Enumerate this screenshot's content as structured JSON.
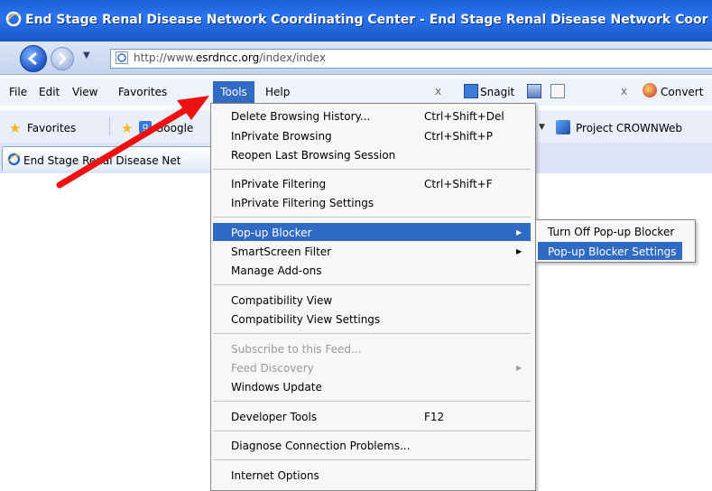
{
  "window": {
    "title": "End Stage Renal Disease Network Coordinating Center - End Stage Renal Disease Network Coor"
  },
  "address": {
    "url_prefix": "http://www.",
    "url_host": "esrdncc.org",
    "url_path": "/index/index"
  },
  "menubar": {
    "items": [
      "File",
      "Edit",
      "View",
      "Favorites",
      "Tools",
      "Help"
    ],
    "snagit_label": "Snagit",
    "convert_label": "Convert",
    "close_glyph": "x"
  },
  "favorites_bar": {
    "favorites_label": "Favorites",
    "google_label": "Google",
    "project_label": "Project CROWNWeb"
  },
  "tab": {
    "label": "End Stage Renal Disease Net"
  },
  "tools_menu": {
    "items": [
      {
        "label": "Delete Browsing History...",
        "shortcut": "Ctrl+Shift+Del"
      },
      {
        "label": "InPrivate Browsing",
        "shortcut": "Ctrl+Shift+P"
      },
      {
        "label": "Reopen Last Browsing Session",
        "shortcut": ""
      },
      {
        "label": "InPrivate Filtering",
        "shortcut": "Ctrl+Shift+F"
      },
      {
        "label": "InPrivate Filtering Settings",
        "shortcut": ""
      },
      {
        "label": "Pop-up Blocker",
        "shortcut": "",
        "submenu": true,
        "highlighted": true
      },
      {
        "label": "SmartScreen Filter",
        "shortcut": "",
        "submenu": true
      },
      {
        "label": "Manage Add-ons",
        "shortcut": ""
      },
      {
        "label": "Compatibility View",
        "shortcut": ""
      },
      {
        "label": "Compatibility View Settings",
        "shortcut": ""
      },
      {
        "label": "Subscribe to this Feed...",
        "shortcut": "",
        "disabled": true
      },
      {
        "label": "Feed Discovery",
        "shortcut": "",
        "submenu": true,
        "disabled": true
      },
      {
        "label": "Windows Update",
        "shortcut": ""
      },
      {
        "label": "Developer Tools",
        "shortcut": "F12"
      },
      {
        "label": "Diagnose Connection Problems...",
        "shortcut": ""
      },
      {
        "label": "Internet Options",
        "shortcut": ""
      }
    ]
  },
  "popup_submenu": {
    "items": [
      {
        "label": "Turn Off Pop-up Blocker",
        "highlighted": false
      },
      {
        "label": "Pop-up Blocker Settings",
        "highlighted": true
      }
    ]
  },
  "colors": {
    "highlight": "#316ac5",
    "titlebar": "#2a74ee",
    "annotation_arrow": "#ee1111"
  }
}
